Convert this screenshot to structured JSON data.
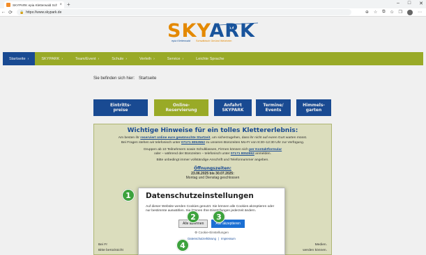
{
  "browser": {
    "tab_title": "SKYPARK epia Kletterwald Schw...",
    "tab_close": "×",
    "new_tab": "+",
    "url": "https://www.skypark.de",
    "win_min": "–",
    "win_max": "□",
    "win_close": "✕"
  },
  "logo": {
    "sky": "SKY",
    "ark": "ARK",
    "sub_left": "epia Kletterwald",
    "sub_right": "Schwäbisch Gmünd Welzheim"
  },
  "nav": {
    "items": [
      {
        "label": "Startseite",
        "caret": "›"
      },
      {
        "label": "SKYPARK",
        "caret": "›"
      },
      {
        "label": "Team/Event",
        "caret": "›"
      },
      {
        "label": "Schule",
        "caret": "›"
      },
      {
        "label": "Verleih",
        "caret": "›"
      },
      {
        "label": "Service",
        "caret": "›"
      },
      {
        "label": "Leichte Sprache",
        "caret": ""
      }
    ]
  },
  "breadcrumb": {
    "prefix": "Sie befinden sich hier:",
    "current": "Startseite"
  },
  "quick_buttons": [
    {
      "line1": "Eintritts-",
      "line2": "preise",
      "color": "#1b4f9c"
    },
    {
      "line1": "Online-",
      "line2": "Reservierung",
      "color": "#a3b52a"
    },
    {
      "line1": "Anfahrt",
      "line2": "SKYPARK",
      "color": "#1b4f9c"
    },
    {
      "line1": "Termine/",
      "line2": "Events",
      "color": "#1b4f9c"
    },
    {
      "line1": "Himmels-",
      "line2": "garten",
      "color": "#1b4f9c"
    }
  ],
  "info": {
    "heading": "Wichtige Hinweise für ein tolles Klettererlebnis:",
    "p1_a": "Am besten ihr ",
    "p1_link": "reserviert online eure gewünschte Startzeit",
    "p1_b": ", um sicherzugehen, dass ihr nicht auf euren Gurt warten müsst.",
    "p1_c": "Bei Fragen stehen wir  telefonisch unter ",
    "p1_phone": "07171 8053552",
    "p1_d": " zu unseren Bürozeiten Mo-Fr von 8:30–12:30 Uhr zur Verfügung.",
    "p2_a": "Gruppen ab 10 Teilnehmern sowie Schulklassen, Firmen können sich ",
    "p2_link": "per Kontaktformular",
    "p2_b": "oder – während der Bürozeiten – telefonisch unter ",
    "p2_phone": "07171 8053552",
    "p2_c": " anmelden.",
    "p3": "Bitte unbedingt immer vollständige Anschrift und Telefonnummer angeben.",
    "hours_title": "Öffnungszeiten:",
    "hours_date": "23.06.2025 bis 30.07.2025:",
    "hours_line": "Montag und Dienstag geschlossen",
    "bottom_left1": "Bei Fr",
    "bottom_right1": "Medien.",
    "bottom_left2": "Bitte berücksicht",
    "bottom_right2": "werden können."
  },
  "cookie": {
    "title": "Datenschutzeinstellungen",
    "text": "Auf dieser Website werden Cookies genutzt. Sie können alle Cookies akzeptieren oder nur bestimmte auswählen. Sie können Ihre Einstellungen jederzeit ändern.",
    "decline": "Alle ablehnen",
    "accept": "Alle akzeptieren",
    "settings_icon": "⚙",
    "settings": "Cookie-Einstellungen",
    "link_privacy": "Datenschutzerklärung",
    "link_sep": "|",
    "link_imprint": "Impressum"
  },
  "markers": [
    "1",
    "2",
    "3",
    "4"
  ],
  "colors": {
    "nav_green": "#a3b52a",
    "brand_blue": "#1b4f9c",
    "brand_orange": "#f39200",
    "accept_blue": "#1b6fd3",
    "marker_green": "#3da23d"
  }
}
